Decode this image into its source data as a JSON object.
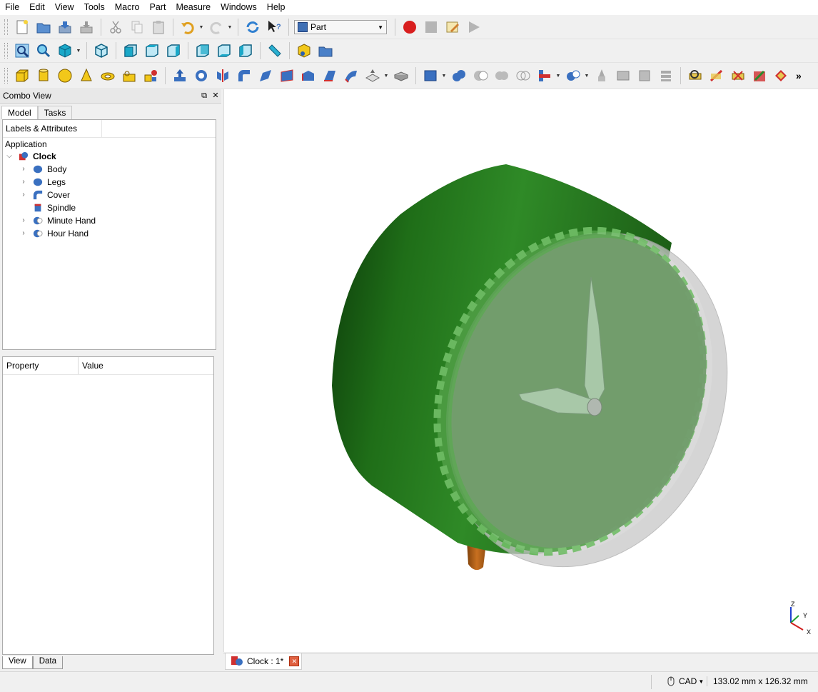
{
  "menu": [
    "File",
    "Edit",
    "View",
    "Tools",
    "Macro",
    "Part",
    "Measure",
    "Windows",
    "Help"
  ],
  "toolbar": {
    "workbench": "Part",
    "more_glyph": "»"
  },
  "combo": {
    "title": "Combo View",
    "tabs": [
      "Model",
      "Tasks"
    ],
    "tree_header": "Labels & Attributes",
    "application_label": "Application",
    "root": "Clock",
    "items": [
      "Body",
      "Legs",
      "Cover",
      "Spindle",
      "Minute Hand",
      "Hour Hand"
    ],
    "property_col": "Property",
    "value_col": "Value",
    "bottom_tabs": [
      "View",
      "Data"
    ]
  },
  "document_tab": "Clock : 1*",
  "status": {
    "nav_style": "CAD",
    "dimensions": "133.02 mm x 126.32 mm"
  },
  "axis_labels": {
    "z": "Z",
    "y": "Y",
    "x": "X"
  },
  "colors": {
    "body_green": "#2f8a27",
    "leg_orange": "#b8641c",
    "cover_grey": "#d0d0d0",
    "record_red": "#d81e1e"
  }
}
